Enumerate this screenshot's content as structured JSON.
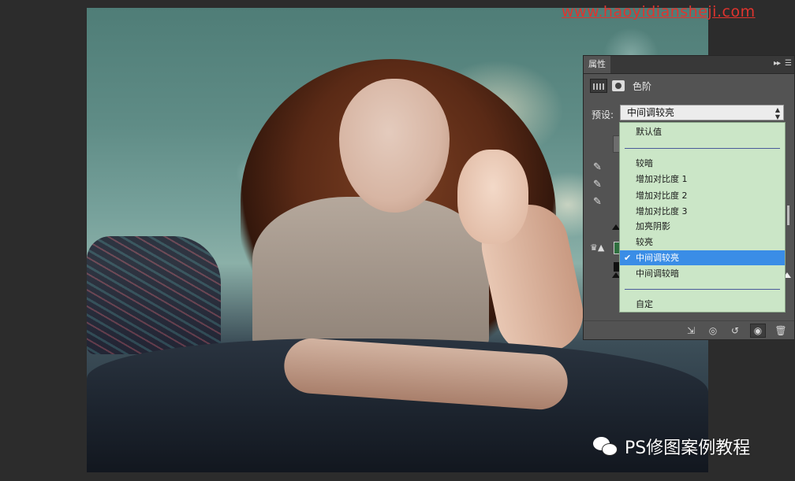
{
  "watermarks": {
    "top_url": "www.haoyidiansheji.com",
    "bottom_brand": "PS修图案例教程",
    "bottom_icon": "wechat-icon"
  },
  "panel": {
    "tab_label": "属性",
    "menu_icons": [
      "collapse-icon",
      "panel-menu-icon"
    ],
    "adjustment_title": "色阶",
    "preset_label": "预设:",
    "preset_value": "中间调较亮",
    "dropdown_options": [
      {
        "label": "默认值",
        "selected": false
      },
      {
        "label": "较暗",
        "selected": false
      },
      {
        "label": "增加对比度 1",
        "selected": false
      },
      {
        "label": "增加对比度 2",
        "selected": false
      },
      {
        "label": "增加对比度 3",
        "selected": false
      },
      {
        "label": "加亮阴影",
        "selected": false
      },
      {
        "label": "较亮",
        "selected": false
      },
      {
        "label": "中间调较亮",
        "selected": true
      },
      {
        "label": "中间调较暗",
        "selected": false
      },
      {
        "label": "自定",
        "selected": false
      }
    ],
    "bottom_icons": [
      "clip-to-layer-icon",
      "view-previous-icon",
      "reset-icon",
      "visibility-icon",
      "trash-icon"
    ],
    "colors": {
      "dropdown_bg": "#cbe6c7",
      "selection": "#3a8de6",
      "panel_bg": "#535353"
    }
  }
}
